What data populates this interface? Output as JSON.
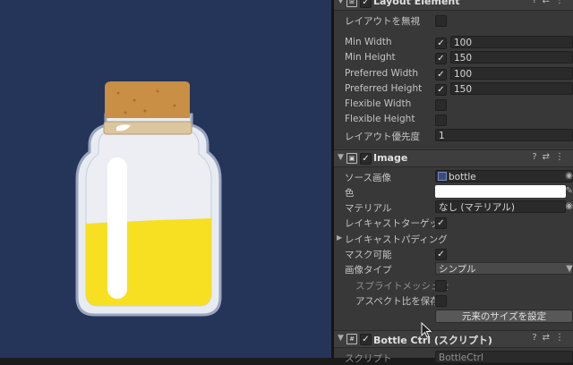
{
  "colors": {
    "scene_bg": "#253459",
    "inspector_bg": "#383838",
    "liquid": "#f7e021",
    "cork": "#c98f45"
  },
  "layout_element": {
    "title": "Layout Element",
    "rows": [
      {
        "label": "レイアウトを無視",
        "checked": false,
        "value": null
      },
      {
        "label": "Min Width",
        "checked": true,
        "value": "100"
      },
      {
        "label": "Min Height",
        "checked": true,
        "value": "150"
      },
      {
        "label": "Preferred Width",
        "checked": true,
        "value": "100"
      },
      {
        "label": "Preferred Height",
        "checked": true,
        "value": "150"
      },
      {
        "label": "Flexible Width",
        "checked": false,
        "value": null
      },
      {
        "label": "Flexible Height",
        "checked": false,
        "value": null
      },
      {
        "label": "レイアウト優先度",
        "checked": null,
        "value": "1"
      }
    ]
  },
  "image": {
    "title": "Image",
    "source_label": "ソース画像",
    "source_value": "bottle",
    "color_label": "色",
    "material_label": "マテリアル",
    "material_value": "なし (マテリアル)",
    "raycast_target_label": "レイキャストターゲット",
    "raycast_padding_label": "レイキャストパディング",
    "maskable_label": "マスク可能",
    "image_type_label": "画像タイプ",
    "image_type_value": "シンプル",
    "use_sprite_mesh_label": "スプライトメッシュを",
    "preserve_aspect_label": "アスペクト比を保存",
    "set_native_size_label": "元来のサイズを設定"
  },
  "bottle_ctrl": {
    "title": "Bottle Ctrl (スクリプト)",
    "script_label": "スクリプト",
    "script_value": "BottleCtrl"
  }
}
